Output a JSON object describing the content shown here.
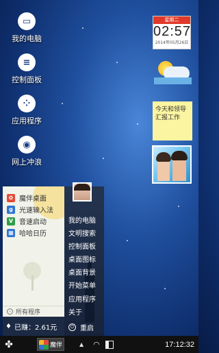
{
  "desktop": {
    "icons": [
      {
        "label": "我的电脑",
        "icon": "computer-icon"
      },
      {
        "label": "控制面板",
        "icon": "control-panel-icon"
      },
      {
        "label": "应用程序",
        "icon": "apps-icon"
      },
      {
        "label": "网上冲浪",
        "icon": "globe-icon"
      }
    ]
  },
  "clock_widget": {
    "day": "星期二",
    "time": "02:57",
    "date": "2014年05月26日"
  },
  "note_widget": {
    "text": "今天和领导汇报工作"
  },
  "start_menu": {
    "programs": [
      {
        "label": "魔伴桌面",
        "icon": "mobo-desktop-icon",
        "color": "#e34a3a"
      },
      {
        "label": "光速输入法",
        "icon": "input-method-icon",
        "color": "#2f76d2"
      },
      {
        "label": "音速启动",
        "icon": "launcher-icon",
        "color": "#2e9e4b"
      },
      {
        "label": "哈哈日历",
        "icon": "calendar-icon",
        "color": "#2f76d2"
      }
    ],
    "all_programs": "所有程序",
    "right_items": [
      "我的电脑",
      "文明搜索",
      "控制面板",
      "桌面图标",
      "桌面背景",
      "开始菜单",
      "应用程序",
      "关于"
    ],
    "earned": "已赚：2.61元",
    "restart": "重启"
  },
  "taskbar": {
    "app_label": "魔伴",
    "time": "17:12:32"
  }
}
